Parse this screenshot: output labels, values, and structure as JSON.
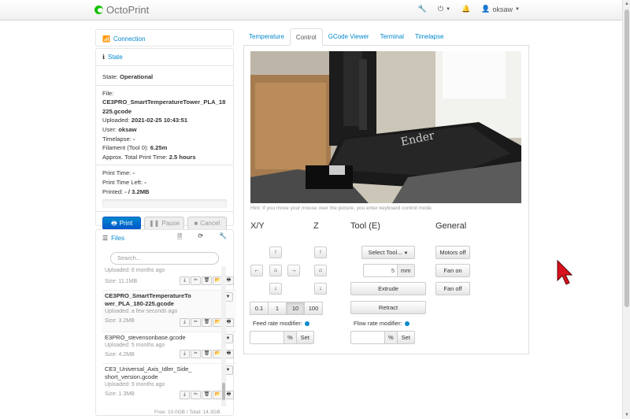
{
  "navbar": {
    "brand": "OctoPrint",
    "user": "oksaw"
  },
  "connection": {
    "title": "Connection"
  },
  "state": {
    "title": "State",
    "state_label": "State:",
    "state_value": "Operational",
    "file_label": "File:",
    "file_value": "CE3PRO_SmartTemperatureTower_PLA_180-225.gcode",
    "file_line1": "CE3PRO_SmartTemperatureTower_PLA_18",
    "file_line2": "225.gcode",
    "uploaded_label": "Uploaded:",
    "uploaded_value": "2021-02-25 10:43:51",
    "user_label": "User:",
    "user_value": "oksaw",
    "timelapse_label": "Timelapse:",
    "timelapse_value": "-",
    "filament_label": "Filament (Tool 0):",
    "filament_value": "6.25m",
    "approx_label": "Approx. Total Print Time:",
    "approx_value": "2.5 hours",
    "print_time_label": "Print Time:",
    "print_time_value": "-",
    "print_left_label": "Print Time Left:",
    "print_left_value": "-",
    "printed_label": "Printed:",
    "printed_value": "- / 3.2MB",
    "progress": 0,
    "print_btn": "Print",
    "pause_btn": "Pause",
    "cancel_btn": "Cancel"
  },
  "files": {
    "title": "Files",
    "search_placeholder": "Search...",
    "items": [
      {
        "name": "",
        "uploaded": "Uploaded: 6 months ago",
        "size": "Size: 11.1MB",
        "bold": false,
        "partial": true
      },
      {
        "name": "CE3PRO_SmartTemperatureTower_PLA_180-225.gcode",
        "name_l1": "CE3PRO_SmartTemperatureTo",
        "name_l2": "wer_PLA_180-225.gcode",
        "uploaded": "Uploaded: a few seconds ago",
        "size": "Size: 3.2MB",
        "bold": true
      },
      {
        "name": "E3PRO_stevensonbase.gcode",
        "uploaded": "Uploaded: 5 months ago",
        "size": "Size: 4.2MB",
        "bold": false
      },
      {
        "name": "CE3_Universal_Axis_Idler_Side_short_version.gcode",
        "name_l1": "CE3_Universal_Axis_Idler_Side_",
        "name_l2": "short_version.gcode",
        "uploaded": "Uploaded: 9 months ago",
        "size": "Size: 1.3MB",
        "bold": false
      }
    ],
    "free_total": "Free: 10.0GB / Total: 14.3GB"
  },
  "tabs": [
    "Temperature",
    "Control",
    "GCode Viewer",
    "Terminal",
    "Timelapse"
  ],
  "active_tab": "Control",
  "control": {
    "hint": "Hint: If you move your mouse over the picture, you enter keyboard control mode.",
    "xy_title": "X/Y",
    "z_title": "Z",
    "tool_title": "Tool (E)",
    "general_title": "General",
    "steps": [
      "0.1",
      "1",
      "10",
      "100"
    ],
    "active_step": "10",
    "select_tool": "Select Tool...",
    "extrude_amount": "5",
    "extrude_unit": "mm",
    "extrude_btn": "Extrude",
    "retract_btn": "Retract",
    "feed_label": "Feed rate modifier:",
    "flow_label": "Flow rate modifier:",
    "percent": "%",
    "set_btn": "Set",
    "motors_off": "Motors off",
    "fan_on": "Fan on",
    "fan_off": "Fan off"
  },
  "icons": {
    "up": "↑",
    "down": "↓",
    "left": "←",
    "right": "→",
    "home": "⌂",
    "print": "🖨",
    "pause": "❚❚",
    "cancel": "■",
    "download": "⤓",
    "cut": "✂",
    "delete": "🗑",
    "folder": "📂",
    "printer": "🖶",
    "chevron": "⌄"
  },
  "colors": {
    "accent": "#0088cc",
    "primary": "#0055cc",
    "brand_green": "#13c100",
    "cursor": "#d9111e"
  }
}
